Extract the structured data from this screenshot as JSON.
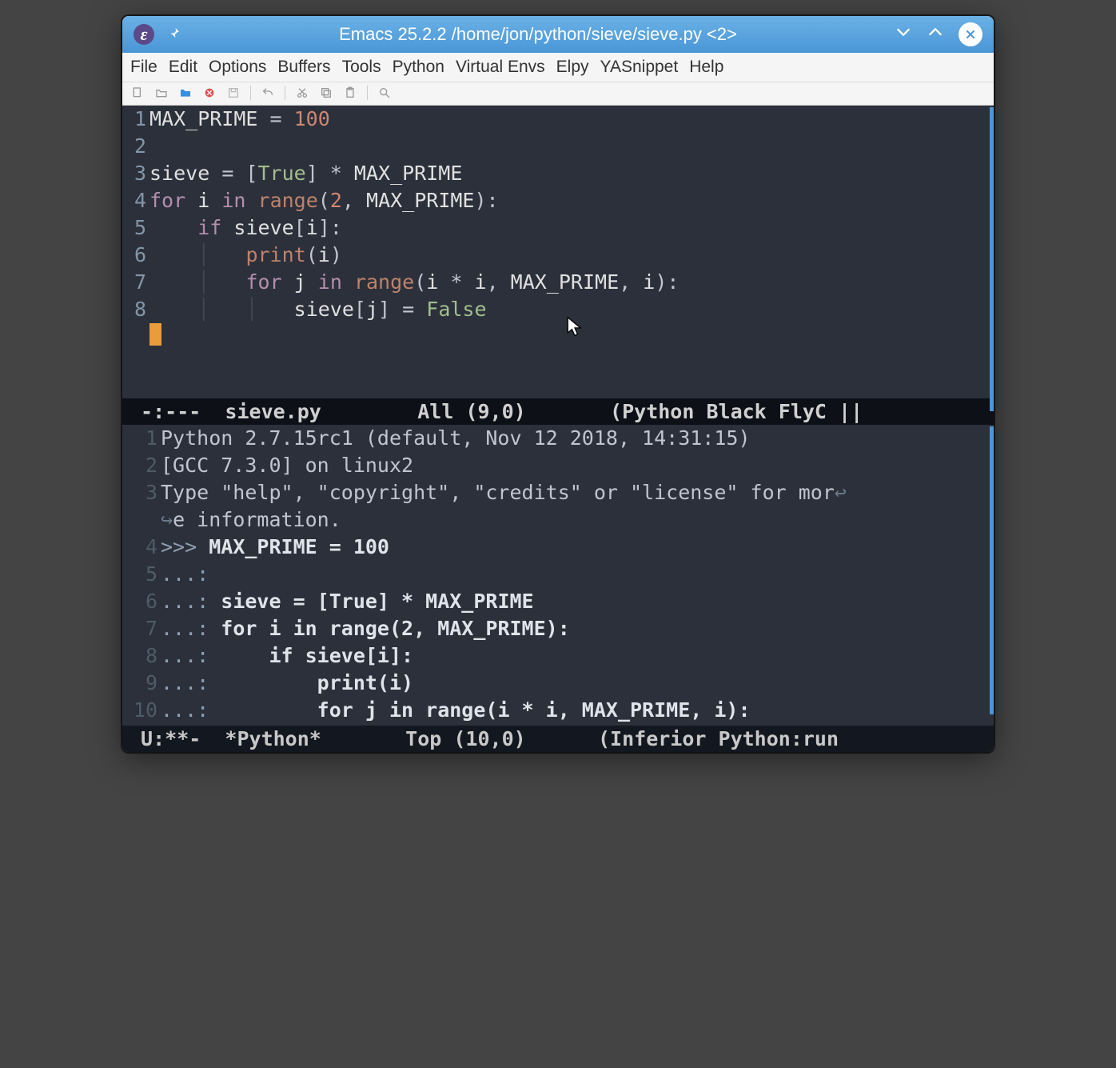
{
  "titlebar": {
    "title": "Emacs 25.2.2 /home/jon/python/sieve/sieve.py <2>"
  },
  "menubar": [
    "File",
    "Edit",
    "Options",
    "Buffers",
    "Tools",
    "Python",
    "Virtual Envs",
    "Elpy",
    "YASnippet",
    "Help"
  ],
  "toolbar_icons": [
    "new-file",
    "open-file",
    "folder",
    "close-red",
    "save",
    "undo",
    "cut",
    "copy",
    "paste",
    "search"
  ],
  "source": {
    "lines": [
      {
        "n": 1,
        "tokens": [
          [
            "var",
            "MAX_PRIME"
          ],
          [
            "op",
            " = "
          ],
          [
            "num",
            "100"
          ]
        ]
      },
      {
        "n": 2,
        "tokens": []
      },
      {
        "n": 3,
        "tokens": [
          [
            "var",
            "sieve"
          ],
          [
            "op",
            " = ["
          ],
          [
            "const-true",
            "True"
          ],
          [
            "op",
            "] * "
          ],
          [
            "var",
            "MAX_PRIME"
          ]
        ]
      },
      {
        "n": 4,
        "tokens": [
          [
            "kw",
            "for"
          ],
          [
            "op",
            " "
          ],
          [
            "var",
            "i"
          ],
          [
            "op",
            " "
          ],
          [
            "kw",
            "in"
          ],
          [
            "op",
            " "
          ],
          [
            "fn",
            "range"
          ],
          [
            "op",
            "("
          ],
          [
            "num",
            "2"
          ],
          [
            "op",
            ", "
          ],
          [
            "var",
            "MAX_PRIME"
          ],
          [
            "op",
            "):"
          ]
        ]
      },
      {
        "n": 5,
        "tokens": [
          [
            "op",
            "    "
          ],
          [
            "kw",
            "if"
          ],
          [
            "op",
            " "
          ],
          [
            "var",
            "sieve"
          ],
          [
            "op",
            "["
          ],
          [
            "var",
            "i"
          ],
          [
            "op",
            "]:"
          ]
        ]
      },
      {
        "n": 6,
        "tokens": [
          [
            "op",
            "    "
          ],
          [
            "ws-guide",
            "│"
          ],
          [
            "op",
            "   "
          ],
          [
            "fn",
            "print"
          ],
          [
            "op",
            "("
          ],
          [
            "var",
            "i"
          ],
          [
            "op",
            ")"
          ]
        ]
      },
      {
        "n": 7,
        "tokens": [
          [
            "op",
            "    "
          ],
          [
            "ws-guide",
            "│"
          ],
          [
            "op",
            "   "
          ],
          [
            "kw",
            "for"
          ],
          [
            "op",
            " "
          ],
          [
            "var",
            "j"
          ],
          [
            "op",
            " "
          ],
          [
            "kw",
            "in"
          ],
          [
            "op",
            " "
          ],
          [
            "fn",
            "range"
          ],
          [
            "op",
            "("
          ],
          [
            "var",
            "i"
          ],
          [
            "op",
            " * "
          ],
          [
            "var",
            "i"
          ],
          [
            "op",
            ", "
          ],
          [
            "var",
            "MAX_PRIME"
          ],
          [
            "op",
            ", "
          ],
          [
            "var",
            "i"
          ],
          [
            "op",
            "):"
          ]
        ]
      },
      {
        "n": 8,
        "tokens": [
          [
            "op",
            "    "
          ],
          [
            "ws-guide",
            "│"
          ],
          [
            "op",
            "   "
          ],
          [
            "ws-guide",
            "│"
          ],
          [
            "op",
            "   "
          ],
          [
            "var",
            "sieve"
          ],
          [
            "op",
            "["
          ],
          [
            "var",
            "j"
          ],
          [
            "op",
            "] = "
          ],
          [
            "const-false",
            "False"
          ]
        ]
      }
    ]
  },
  "modeline_top": " -:---  sieve.py        All (9,0)       (Python Black FlyC ||",
  "repl": {
    "lines": [
      {
        "n": 1,
        "plain": "Python 2.7.15rc1 (default, Nov 12 2018, 14:31:15)"
      },
      {
        "n": 2,
        "plain": "[GCC 7.3.0] on linux2"
      },
      {
        "n": 3,
        "plain": "Type \"help\", \"copyright\", \"credits\" or \"license\" for mor",
        "wrap": true
      },
      {
        "n": "",
        "plain": "e information.",
        "cont": true
      },
      {
        "n": 4,
        "prompt": ">>> ",
        "bold": "MAX_PRIME = 100"
      },
      {
        "n": 5,
        "prompt": "...: ",
        "bold": ""
      },
      {
        "n": 6,
        "prompt": "...: ",
        "bold": "sieve = [True] * MAX_PRIME"
      },
      {
        "n": 7,
        "prompt": "...: ",
        "bold": "for i in range(2, MAX_PRIME):"
      },
      {
        "n": 8,
        "prompt": "...: ",
        "bold": "    if sieve[i]:"
      },
      {
        "n": 9,
        "prompt": "...: ",
        "bold": "        print(i)"
      },
      {
        "n": 10,
        "prompt": "...: ",
        "bold": "        for j in range(i * i, MAX_PRIME, i):",
        "boxcursor": true
      }
    ]
  },
  "modeline_bottom": " U:**-  *Python*       Top (10,0)      (Inferior Python:run "
}
